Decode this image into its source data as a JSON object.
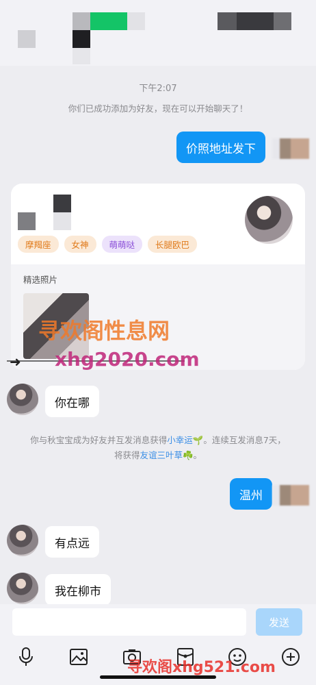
{
  "chat": {
    "timestamp": "下午2:07",
    "added_notice": "你们已成功添加为好友，现在可以开始聊天了！",
    "messages": {
      "m1": "价照地址发下",
      "m2": "你在哪",
      "m3": "温州",
      "m4": "有点远",
      "m5": "我在柳市"
    },
    "streak_notice": {
      "part1": "你与秋宝宝成为好友并互发消息获得",
      "link1": "小幸运🌱",
      "part2": "。连续互发消息7天，将获得",
      "link2": "友谊三叶草☘️",
      "part3": "。"
    }
  },
  "profile_card": {
    "tags": [
      "摩羯座",
      "女神",
      "萌萌哒",
      "长腿欧巴"
    ],
    "photos_label": "精选照片"
  },
  "watermarks": {
    "w1": "寻欢阁性息网",
    "w2": "xhg2020.com",
    "w3": "寻欢阁xhg521.com"
  },
  "input": {
    "placeholder": "",
    "send_label": "发送"
  },
  "toolbar_icons": [
    "microphone-icon",
    "image-icon",
    "camera-icon",
    "red-packet-icon",
    "emoji-icon",
    "plus-icon"
  ],
  "colors": {
    "accent": "#1296f5",
    "send_disabled": "#a9d6fb",
    "watermark": "#f07a2a"
  }
}
